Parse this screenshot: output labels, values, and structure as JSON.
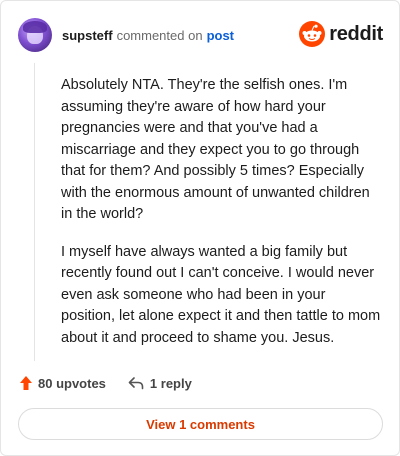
{
  "header": {
    "username": "supsteff",
    "action": "commented on",
    "link": "post",
    "brand": "reddit"
  },
  "comment": {
    "paragraphs": [
      "Absolutely NTA. They're the selfish ones. I'm assuming they're aware of how hard your pregnancies were and that you've had a miscarriage and they expect you to go through that for them? And possibly 5 times? Especially with the enormous amount of unwanted children in the world?",
      "I myself have always wanted a big family but recently found out I can't conceive. I would never even ask someone who had been in your position, let alone expect it and then tattle to mom about it and proceed to shame you. Jesus."
    ]
  },
  "footer": {
    "upvotes": "80 upvotes",
    "replies": "1 reply"
  },
  "view_button": "View 1 comments",
  "colors": {
    "accent": "#d93a00",
    "upvote": "#ff4500",
    "link": "#0b5fd8"
  }
}
